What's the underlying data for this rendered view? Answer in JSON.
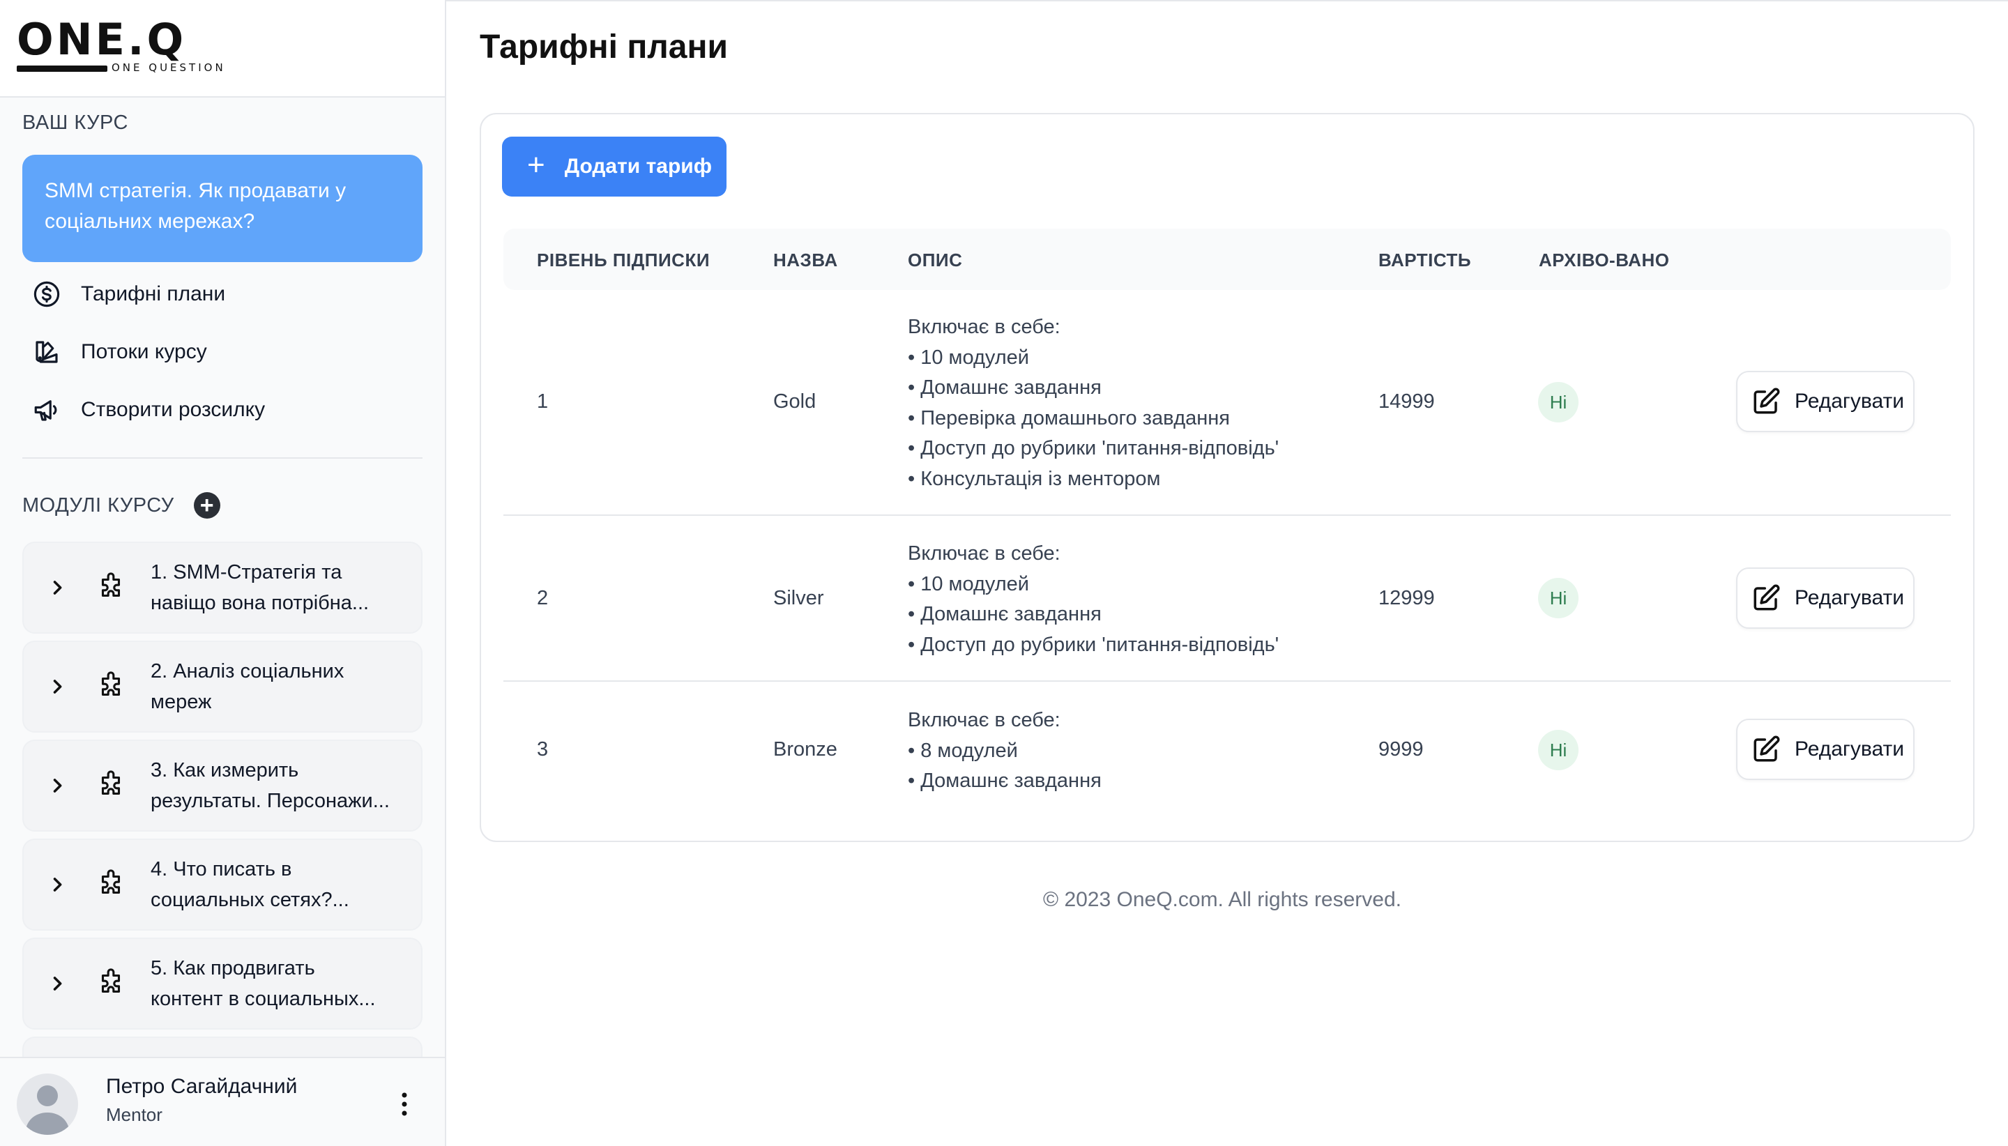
{
  "brand": {
    "logo": "ONE.Q",
    "tagline": "ONE QUESTION"
  },
  "sidebar": {
    "course_section_title": "ВАШ КУРС",
    "course_title": "SMM стратегія. Як продавати у соціальних мережах?",
    "nav": [
      {
        "label": "Тарифні плани",
        "icon": "dollar-circle-icon"
      },
      {
        "label": "Потоки курсу",
        "icon": "swatch-book-icon"
      },
      {
        "label": "Створити розсилку",
        "icon": "megaphone-icon"
      }
    ],
    "modules_title": "МОДУЛІ КУРСУ",
    "modules": [
      {
        "label": "1. SMM-Стратегія та\nнавіщо вона потрібна..."
      },
      {
        "label": "2. Аналіз соціальних\nмереж"
      },
      {
        "label": "3. Как измерить\nрезультаты. Персонажи..."
      },
      {
        "label": "4. Что писать в\nсоциальных сетях?..."
      },
      {
        "label": "5. Как продвигать\nконтент в социальных..."
      }
    ],
    "user": {
      "name": "Петро Сагайдачний",
      "role": "Mentor"
    }
  },
  "page": {
    "title": "Тарифні плани",
    "add_button": "Додати тариф",
    "columns": {
      "level": "РІВЕНЬ ПІДПИСКИ",
      "name": "НАЗВА",
      "description": "ОПИС",
      "price": "ВАРТІСТЬ",
      "archived": "АРХІВО-ВАНО"
    },
    "edit_label": "Редагувати",
    "rows": [
      {
        "level": "1",
        "name": "Gold",
        "price": "14999",
        "archived": "Ні",
        "description": "Включає в себе:\n• 10 модулей\n• Домашнє завдання\n• Перевірка домашнього завдання\n• Доступ до рубрики 'питання-відповідь'\n• Консультація із ментором"
      },
      {
        "level": "2",
        "name": "Silver",
        "price": "12999",
        "archived": "Ні",
        "description": "Включає в себе:\n• 10 модулей\n• Домашнє завдання\n• Доступ до рубрики 'питання-відповідь'"
      },
      {
        "level": "3",
        "name": "Bronze",
        "price": "9999",
        "archived": "Ні",
        "description": "Включає в себе:\n• 8 модулей\n• Домашнє завдання"
      }
    ]
  },
  "footer": "© 2023 OneQ.com. All rights reserved.",
  "colors": {
    "accent": "#3b82f6",
    "course_card": "#60a5fa",
    "badge_bg": "#e7f6ec",
    "badge_text": "#2e7d4f"
  }
}
